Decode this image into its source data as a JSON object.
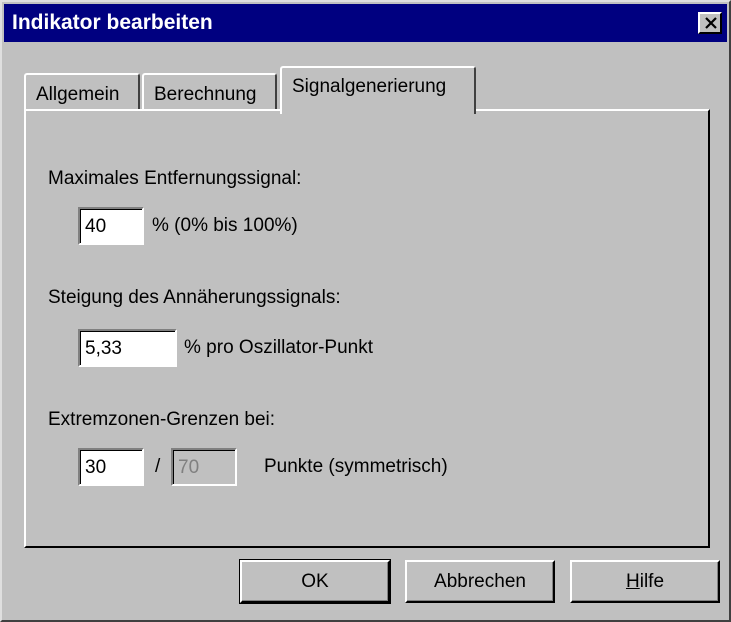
{
  "window": {
    "title": "Indikator bearbeiten"
  },
  "tabs": [
    {
      "label": "Allgemein",
      "active": false
    },
    {
      "label": "Berechnung",
      "active": false
    },
    {
      "label": "Signalgenerierung",
      "active": true
    }
  ],
  "panel": {
    "max_signal": {
      "label": "Maximales Entfernungssignal:",
      "value": "40",
      "suffix": "%  (0% bis 100%)"
    },
    "approach_slope": {
      "label": "Steigung des Annäherungssignals:",
      "value": "5,33",
      "suffix": "% pro Oszillator-Punkt"
    },
    "extreme_zones": {
      "label": "Extremzonen-Grenzen bei:",
      "lower_value": "30",
      "separator": "/",
      "upper_value": "70",
      "suffix": "Punkte  (symmetrisch)"
    }
  },
  "buttons": {
    "ok": "OK",
    "cancel": "Abbrechen",
    "help_mnemonic": "H",
    "help_rest": "ilfe"
  },
  "icons": {
    "close": "close-icon"
  }
}
